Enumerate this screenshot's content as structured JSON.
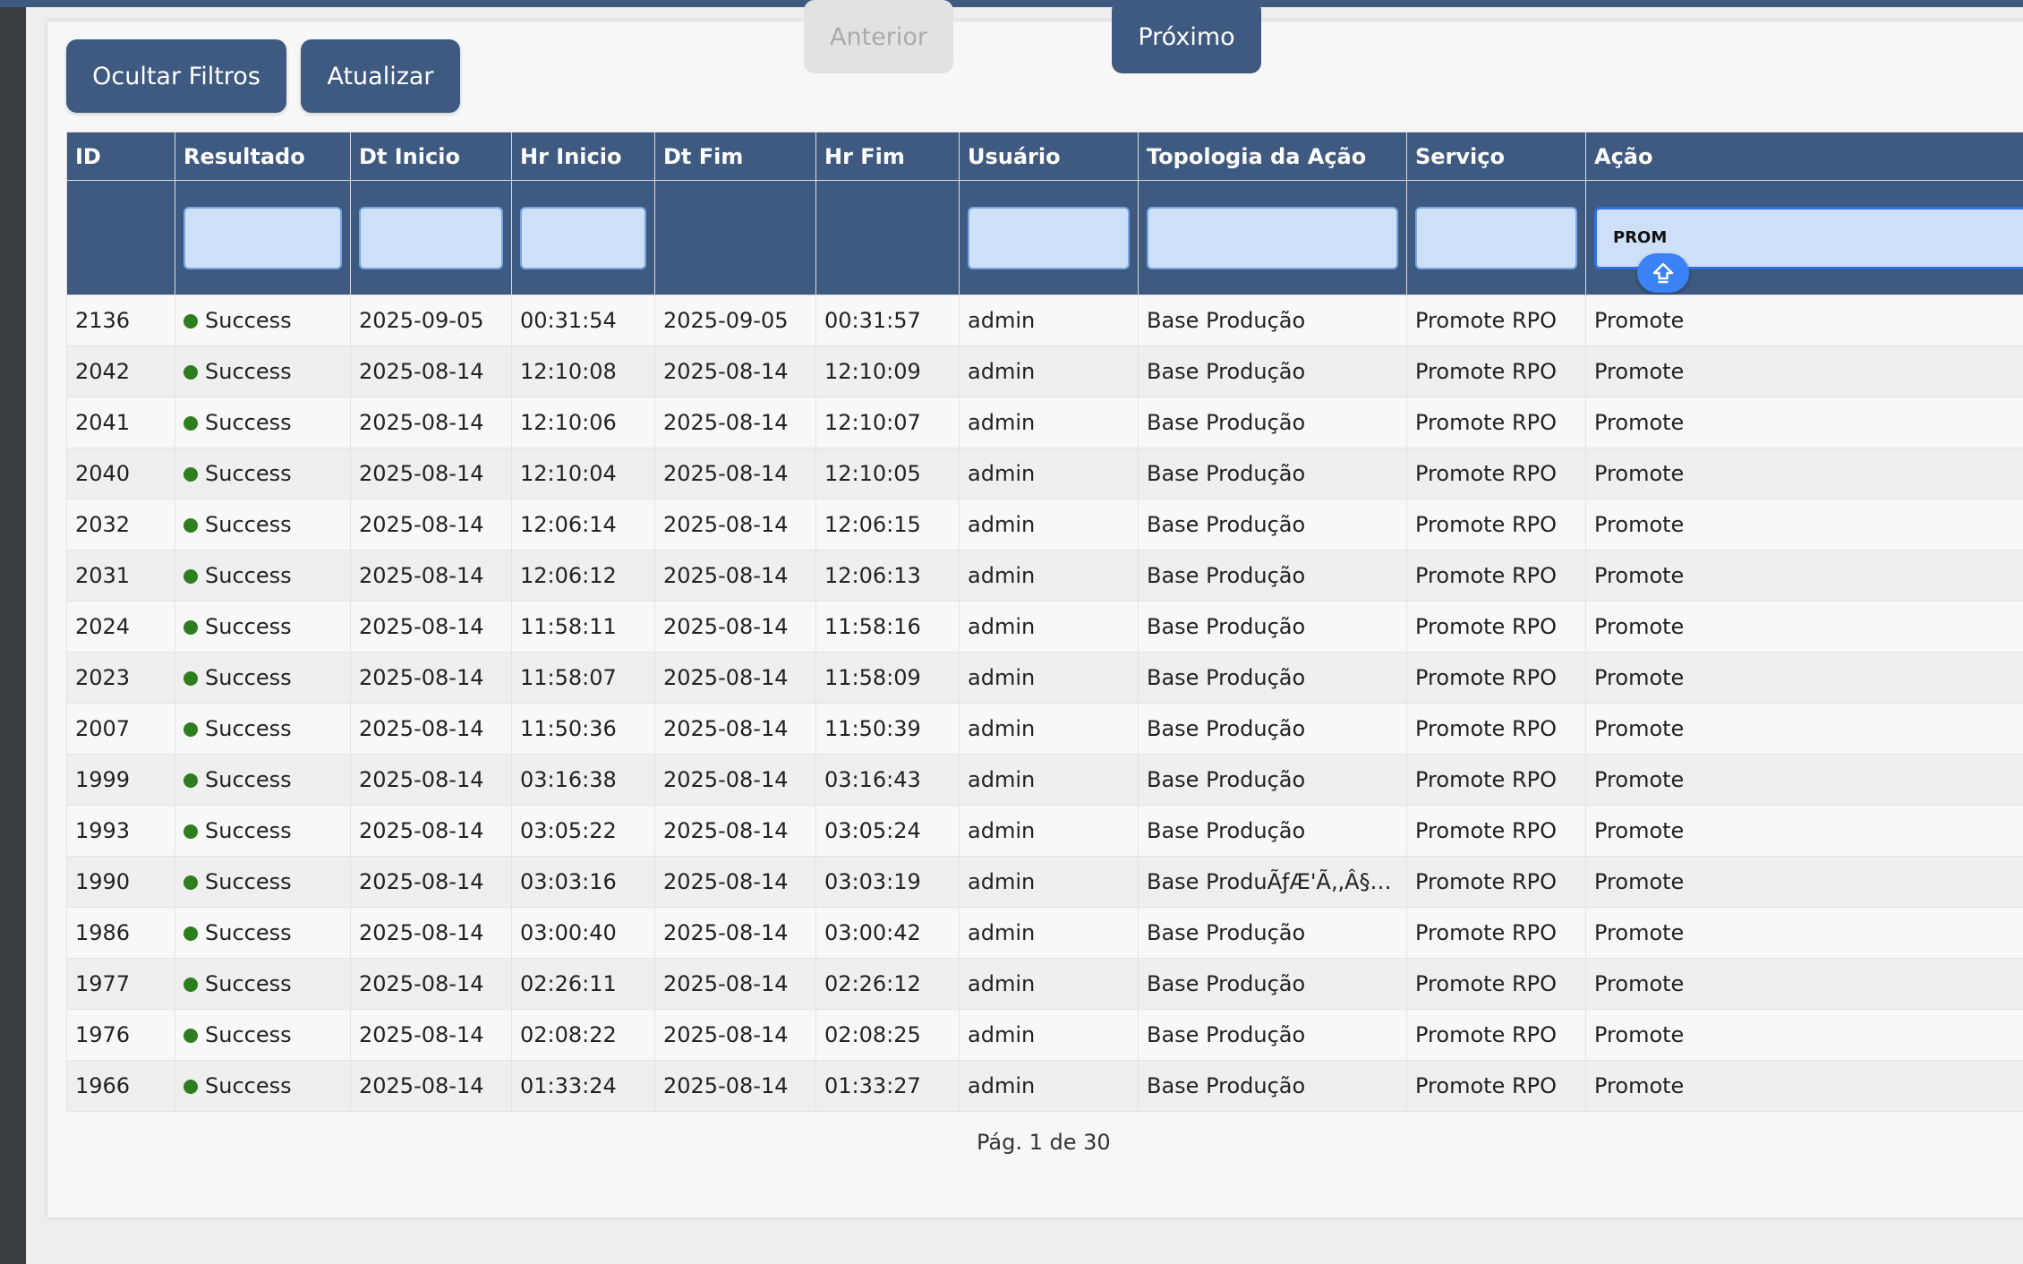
{
  "toolbar": {
    "hide_filters_label": "Ocultar Filtros",
    "refresh_label": "Atualizar"
  },
  "table": {
    "columns": [
      "ID",
      "Resultado",
      "Dt Inicio",
      "Hr Inicio",
      "Dt Fim",
      "Hr Fim",
      "Usuário",
      "Topologia da Ação",
      "Serviço",
      "Ação"
    ],
    "filters": {
      "resultado": "",
      "dt_inicio": "",
      "hr_inicio": "",
      "usuario": "",
      "topologia": "",
      "servico": "",
      "acao": "PROM"
    },
    "rows": [
      [
        "2136",
        "Success",
        "2025-09-05",
        "00:31:54",
        "2025-09-05",
        "00:31:57",
        "admin",
        "Base Produção",
        "Promote RPO",
        "Promote"
      ],
      [
        "2042",
        "Success",
        "2025-08-14",
        "12:10:08",
        "2025-08-14",
        "12:10:09",
        "admin",
        "Base Produção",
        "Promote RPO",
        "Promote"
      ],
      [
        "2041",
        "Success",
        "2025-08-14",
        "12:10:06",
        "2025-08-14",
        "12:10:07",
        "admin",
        "Base Produção",
        "Promote RPO",
        "Promote"
      ],
      [
        "2040",
        "Success",
        "2025-08-14",
        "12:10:04",
        "2025-08-14",
        "12:10:05",
        "admin",
        "Base Produção",
        "Promote RPO",
        "Promote"
      ],
      [
        "2032",
        "Success",
        "2025-08-14",
        "12:06:14",
        "2025-08-14",
        "12:06:15",
        "admin",
        "Base Produção",
        "Promote RPO",
        "Promote"
      ],
      [
        "2031",
        "Success",
        "2025-08-14",
        "12:06:12",
        "2025-08-14",
        "12:06:13",
        "admin",
        "Base Produção",
        "Promote RPO",
        "Promote"
      ],
      [
        "2024",
        "Success",
        "2025-08-14",
        "11:58:11",
        "2025-08-14",
        "11:58:16",
        "admin",
        "Base Produção",
        "Promote RPO",
        "Promote"
      ],
      [
        "2023",
        "Success",
        "2025-08-14",
        "11:58:07",
        "2025-08-14",
        "11:58:09",
        "admin",
        "Base Produção",
        "Promote RPO",
        "Promote"
      ],
      [
        "2007",
        "Success",
        "2025-08-14",
        "11:50:36",
        "2025-08-14",
        "11:50:39",
        "admin",
        "Base Produção",
        "Promote RPO",
        "Promote"
      ],
      [
        "1999",
        "Success",
        "2025-08-14",
        "03:16:38",
        "2025-08-14",
        "03:16:43",
        "admin",
        "Base Produção",
        "Promote RPO",
        "Promote"
      ],
      [
        "1993",
        "Success",
        "2025-08-14",
        "03:05:22",
        "2025-08-14",
        "03:05:24",
        "admin",
        "Base Produção",
        "Promote RPO",
        "Promote"
      ],
      [
        "1990",
        "Success",
        "2025-08-14",
        "03:03:16",
        "2025-08-14",
        "03:03:19",
        "admin",
        "Base ProduÃƒÆ'Ã‚,Â§Ãƒ...",
        "Promote RPO",
        "Promote"
      ],
      [
        "1986",
        "Success",
        "2025-08-14",
        "03:00:40",
        "2025-08-14",
        "03:00:42",
        "admin",
        "Base Produção",
        "Promote RPO",
        "Promote"
      ],
      [
        "1977",
        "Success",
        "2025-08-14",
        "02:26:11",
        "2025-08-14",
        "02:26:12",
        "admin",
        "Base Produção",
        "Promote RPO",
        "Promote"
      ],
      [
        "1976",
        "Success",
        "2025-08-14",
        "02:08:22",
        "2025-08-14",
        "02:08:25",
        "admin",
        "Base Produção",
        "Promote RPO",
        "Promote"
      ],
      [
        "1966",
        "Success",
        "2025-08-14",
        "01:33:24",
        "2025-08-14",
        "01:33:27",
        "admin",
        "Base Produção",
        "Promote RPO",
        "Promote"
      ]
    ]
  },
  "pagination": {
    "prev_label": "Anterior",
    "page_info": "Pág. 1 de 30",
    "next_label": "Próximo"
  },
  "icons": {
    "keyboard_shift": "shift-arrow-icon",
    "status_success": "success-dot-icon"
  },
  "colors": {
    "header_bg": "#3f5a80",
    "button_bg": "#3e5a80",
    "filter_input_bg": "#cde0f7",
    "success_dot": "#2e7d1f",
    "shift_badge": "#3b82f6"
  }
}
